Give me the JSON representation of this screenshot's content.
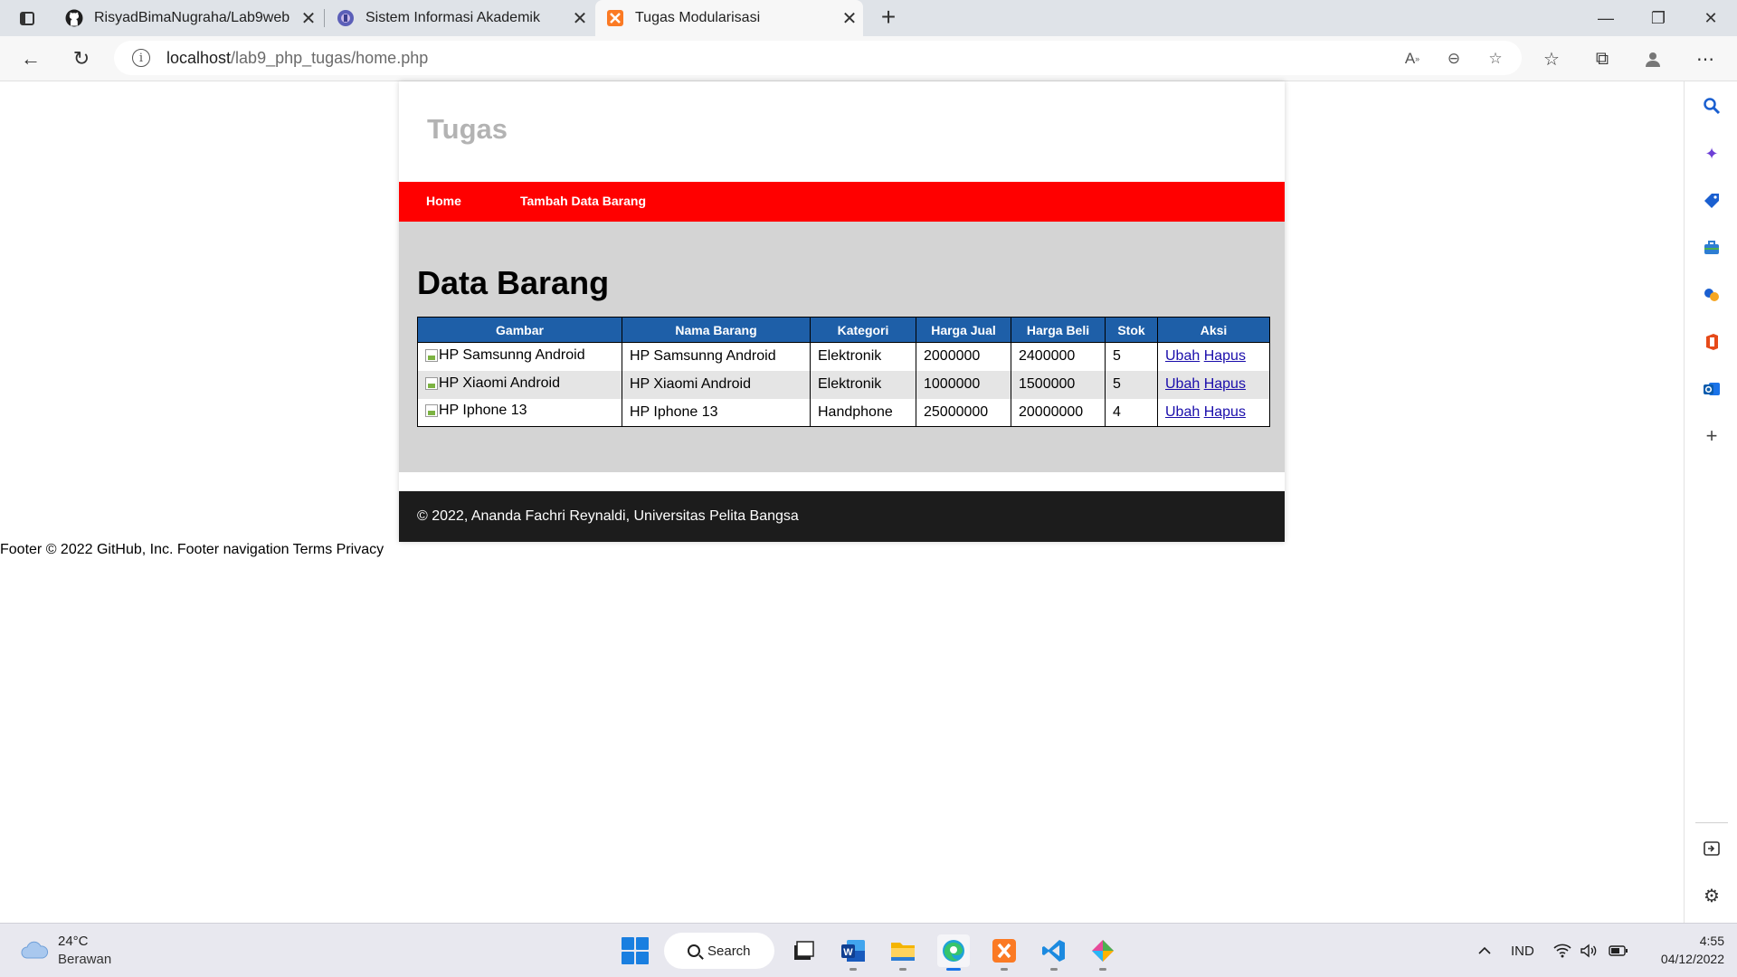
{
  "browser": {
    "tabs": [
      {
        "title": "RisyadBimaNugraha/Lab9web",
        "icon": "github-icon"
      },
      {
        "title": "Sistem Informasi Akademik",
        "icon": "university-icon"
      },
      {
        "title": "Tugas Modularisasi",
        "icon": "xampp-icon",
        "active": true
      }
    ],
    "url_host": "localhost",
    "url_path": "/lab9_php_tugas/home.php"
  },
  "site": {
    "title": "Tugas",
    "nav": {
      "home": "Home",
      "add": "Tambah Data Barang"
    },
    "heading": "Data Barang",
    "table": {
      "headers": [
        "Gambar",
        "Nama Barang",
        "Kategori",
        "Harga Jual",
        "Harga Beli",
        "Stok",
        "Aksi"
      ],
      "rows": [
        {
          "gambar_alt": "HP Samsunng Android",
          "nama": "HP Samsunng Android",
          "kategori": "Elektronik",
          "harga_jual": "2000000",
          "harga_beli": "2400000",
          "stok": "5"
        },
        {
          "gambar_alt": "HP Xiaomi Android",
          "nama": "HP Xiaomi Android",
          "kategori": "Elektronik",
          "harga_jual": "1000000",
          "harga_beli": "1500000",
          "stok": "5"
        },
        {
          "gambar_alt": "HP Iphone 13",
          "nama": "HP Iphone 13",
          "kategori": "Handphone",
          "harga_jual": "25000000",
          "harga_beli": "20000000",
          "stok": "4"
        }
      ],
      "action_edit": "Ubah",
      "action_delete": "Hapus"
    },
    "footer": "© 2022, Ananda Fachri Reynaldi, Universitas Pelita Bangsa",
    "outer_footer": "Footer © 2022 GitHub, Inc. Footer navigation Terms Privacy"
  },
  "taskbar": {
    "weather_temp": "24°C",
    "weather_desc": "Berawan",
    "search_label": "Search",
    "language": "IND",
    "time": "4:55",
    "date": "04/12/2022"
  },
  "colors": {
    "nav_red": "#ff0000",
    "table_header_blue": "#1e5fa8",
    "content_gray": "#d4d4d4",
    "footer_dark": "#1c1c1c"
  }
}
